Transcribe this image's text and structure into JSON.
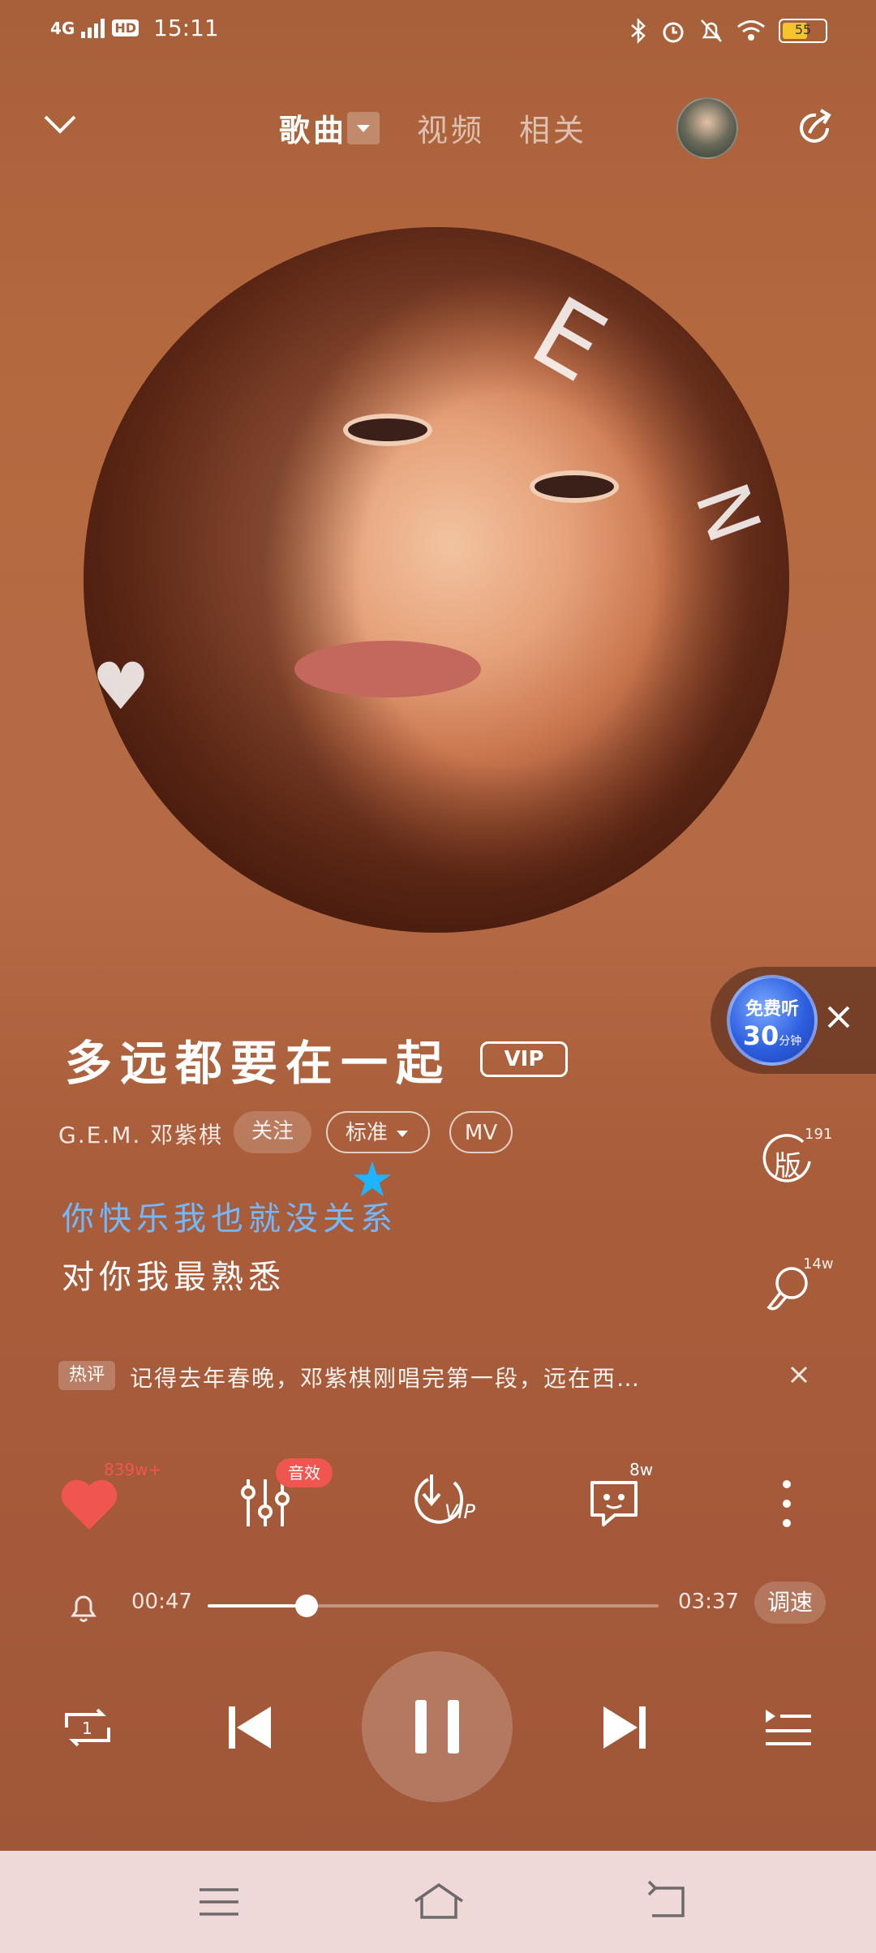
{
  "status_bar": {
    "network": "4G",
    "hd": "HD",
    "time": "15:11",
    "battery": "55"
  },
  "nav": {
    "tabs": [
      "歌曲",
      "视频",
      "相关"
    ]
  },
  "promo": {
    "label_top": "免费听",
    "minutes": "30",
    "unit": "分钟"
  },
  "song": {
    "title": "多远都要在一起",
    "vip": "VIP",
    "artist": "G.E.M. 邓紫棋",
    "follow": "关注",
    "quality": "标准",
    "mv": "MV"
  },
  "side": {
    "version_count": "191",
    "version_label": "版",
    "ringtone_count": "14w"
  },
  "lyrics": {
    "line1": "你快乐我也就没关系",
    "line2": "对你我最熟悉"
  },
  "hot_comment": {
    "tag": "热评",
    "text": "记得去年春晚，邓紫棋刚唱完第一段，远在西…"
  },
  "actions": {
    "like_count": "839w+",
    "fx_badge": "音效",
    "download_label": "VIP",
    "comment_count": "8w"
  },
  "progress": {
    "current": "00:47",
    "total": "03:37",
    "fraction": 0.22,
    "speed_label": "调速"
  },
  "colors": {
    "accent_like": "#f0554f",
    "lyric_active": "#72b8ff",
    "sys_nav_bg": "#eed8d8"
  }
}
